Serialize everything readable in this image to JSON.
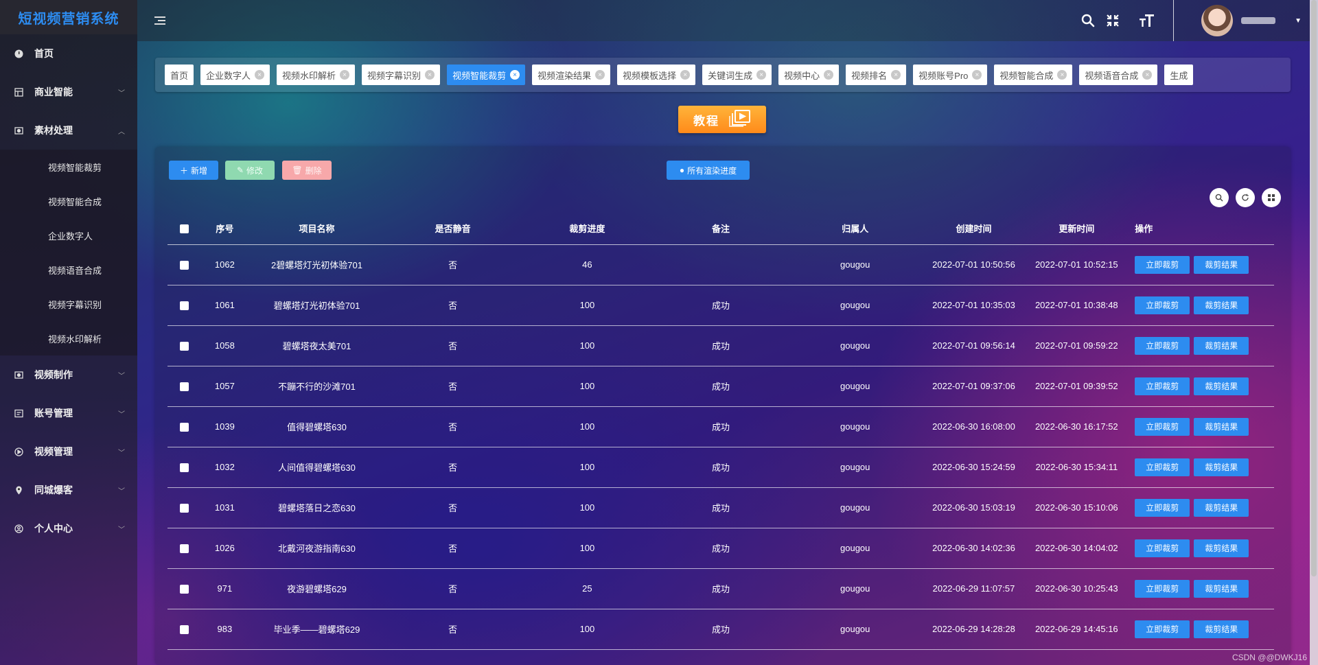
{
  "app": {
    "title": "短视频营销系统"
  },
  "sidebar": {
    "items": [
      {
        "label": "首页",
        "icon": "dashboard-icon",
        "expandable": false
      },
      {
        "label": "商业智能",
        "icon": "grid-icon",
        "expandable": true
      },
      {
        "label": "素材处理",
        "icon": "media-icon",
        "expandable": true,
        "expanded": true
      }
    ],
    "sub_items": [
      "视频智能裁剪",
      "视频智能合成",
      "企业数字人",
      "视频语音合成",
      "视频字幕识别",
      "视频水印解析"
    ],
    "items_after": [
      {
        "label": "视频制作",
        "icon": "media-icon",
        "expandable": true
      },
      {
        "label": "账号管理",
        "icon": "account-icon",
        "expandable": true
      },
      {
        "label": "视频管理",
        "icon": "video-icon",
        "expandable": true
      },
      {
        "label": "同城爆客",
        "icon": "location-icon",
        "expandable": true
      },
      {
        "label": "个人中心",
        "icon": "user-icon",
        "expandable": true
      }
    ]
  },
  "tags": [
    {
      "label": "首页",
      "closable": false,
      "active": false
    },
    {
      "label": "企业数字人",
      "closable": true,
      "active": false
    },
    {
      "label": "视频水印解析",
      "closable": true,
      "active": false
    },
    {
      "label": "视频字幕识别",
      "closable": true,
      "active": false
    },
    {
      "label": "视频智能裁剪",
      "closable": true,
      "active": true
    },
    {
      "label": "视频渲染结果",
      "closable": true,
      "active": false
    },
    {
      "label": "视频模板选择",
      "closable": true,
      "active": false
    },
    {
      "label": "关键词生成",
      "closable": true,
      "active": false
    },
    {
      "label": "视频中心",
      "closable": true,
      "active": false
    },
    {
      "label": "视频排名",
      "closable": true,
      "active": false
    },
    {
      "label": "视频账号Pro",
      "closable": true,
      "active": false
    },
    {
      "label": "视频智能合成",
      "closable": true,
      "active": false
    },
    {
      "label": "视频语音合成",
      "closable": true,
      "active": false
    },
    {
      "label": "生成",
      "closable": false,
      "active": false
    }
  ],
  "tutorial": {
    "label": "教程"
  },
  "toolbar": {
    "add_label": "新增",
    "edit_label": "修改",
    "delete_label": "删除",
    "progress_label": "所有渲染进度"
  },
  "table": {
    "headers": [
      "序号",
      "项目名称",
      "是否静音",
      "裁剪进度",
      "备注",
      "归属人",
      "创建时间",
      "更新时间",
      "操作"
    ],
    "action_labels": [
      "立即裁剪",
      "裁剪结果"
    ],
    "rows": [
      {
        "id": "1062",
        "name": "2碧螺塔灯光初体验701",
        "mute": "否",
        "progress": "46",
        "note": "",
        "owner": "gougou",
        "created": "2022-07-01 10:50:56",
        "updated": "2022-07-01 10:52:15"
      },
      {
        "id": "1061",
        "name": "碧螺塔灯光初体验701",
        "mute": "否",
        "progress": "100",
        "note": "成功",
        "owner": "gougou",
        "created": "2022-07-01 10:35:03",
        "updated": "2022-07-01 10:38:48"
      },
      {
        "id": "1058",
        "name": "碧螺塔夜太美701",
        "mute": "否",
        "progress": "100",
        "note": "成功",
        "owner": "gougou",
        "created": "2022-07-01 09:56:14",
        "updated": "2022-07-01 09:59:22"
      },
      {
        "id": "1057",
        "name": "不蹦不行的沙滩701",
        "mute": "否",
        "progress": "100",
        "note": "成功",
        "owner": "gougou",
        "created": "2022-07-01 09:37:06",
        "updated": "2022-07-01 09:39:52"
      },
      {
        "id": "1039",
        "name": "值得碧螺塔630",
        "mute": "否",
        "progress": "100",
        "note": "成功",
        "owner": "gougou",
        "created": "2022-06-30 16:08:00",
        "updated": "2022-06-30 16:17:52"
      },
      {
        "id": "1032",
        "name": "人间值得碧螺塔630",
        "mute": "否",
        "progress": "100",
        "note": "成功",
        "owner": "gougou",
        "created": "2022-06-30 15:24:59",
        "updated": "2022-06-30 15:34:11"
      },
      {
        "id": "1031",
        "name": "碧螺塔落日之恋630",
        "mute": "否",
        "progress": "100",
        "note": "成功",
        "owner": "gougou",
        "created": "2022-06-30 15:03:19",
        "updated": "2022-06-30 15:10:06"
      },
      {
        "id": "1026",
        "name": "北戴河夜游指南630",
        "mute": "否",
        "progress": "100",
        "note": "成功",
        "owner": "gougou",
        "created": "2022-06-30 14:02:36",
        "updated": "2022-06-30 14:04:02"
      },
      {
        "id": "971",
        "name": "夜游碧螺塔629",
        "mute": "否",
        "progress": "25",
        "note": "成功",
        "owner": "gougou",
        "created": "2022-06-29 11:07:57",
        "updated": "2022-06-30 10:25:43"
      },
      {
        "id": "983",
        "name": "毕业季——碧螺塔629",
        "mute": "否",
        "progress": "100",
        "note": "成功",
        "owner": "gougou",
        "created": "2022-06-29 14:28:28",
        "updated": "2022-06-29 14:45:16"
      }
    ]
  },
  "watermark": "CSDN @@DWKJ16",
  "colors": {
    "accent": "#2d8cf0",
    "logo": "#2d8cf0",
    "tutorial": "#ff9a24",
    "edit": "#8fd9b0",
    "delete": "#f7a8aa"
  }
}
